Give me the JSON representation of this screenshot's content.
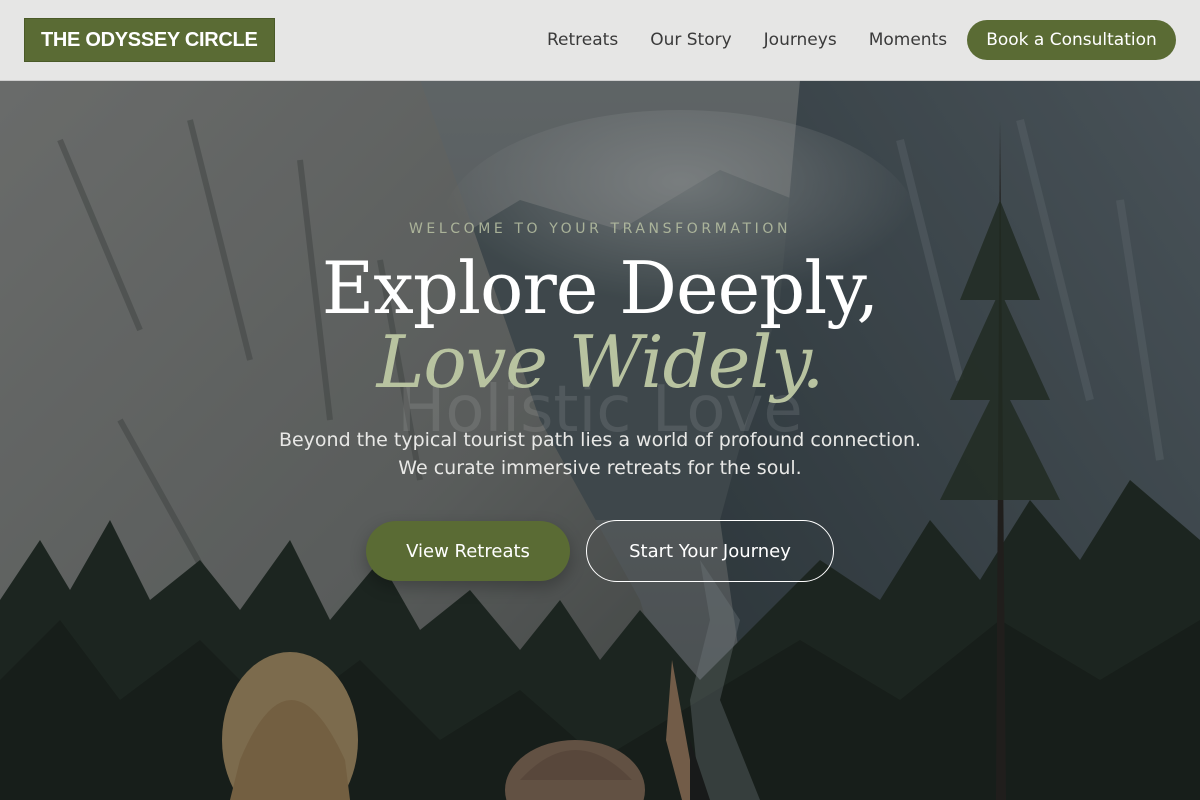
{
  "brand": {
    "name": "THE ODYSSEY CIRCLE"
  },
  "nav": {
    "items": [
      "Retreats",
      "Our Story",
      "Journeys",
      "Moments"
    ],
    "cta": "Book a Consultation"
  },
  "hero": {
    "eyebrow": "WELCOME TO YOUR TRANSFORMATION",
    "headline": "Explore Deeply,",
    "headline_accent": "Love Widely.",
    "ghost_text": "Holistic Love",
    "subtext_lines": [
      "Beyond the typical tourist path lies a world of profound connection.",
      "We curate immersive retreats for the soul."
    ],
    "primary_button": "View Retreats",
    "secondary_button": "Start Your Journey"
  },
  "colors": {
    "accent": "#5a6b34",
    "accent_light": "#b8c3a0",
    "header_bg": "#f0f0ef"
  }
}
